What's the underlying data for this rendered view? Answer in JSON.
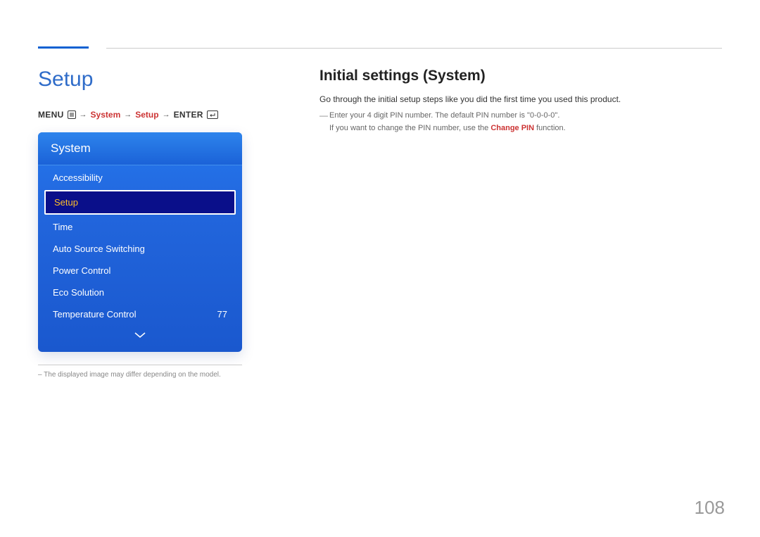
{
  "left": {
    "title": "Setup",
    "breadcrumb": {
      "menu": "MENU",
      "system": "System",
      "setup": "Setup",
      "enter": "ENTER"
    },
    "panel": {
      "header": "System",
      "items": [
        {
          "label": "Accessibility",
          "value": "",
          "selected": false
        },
        {
          "label": "Setup",
          "value": "",
          "selected": true
        },
        {
          "label": "Time",
          "value": "",
          "selected": false
        },
        {
          "label": "Auto Source Switching",
          "value": "",
          "selected": false
        },
        {
          "label": "Power Control",
          "value": "",
          "selected": false
        },
        {
          "label": "Eco Solution",
          "value": "",
          "selected": false
        },
        {
          "label": "Temperature Control",
          "value": "77",
          "selected": false
        }
      ]
    },
    "disclaimer": "– The displayed image may differ depending on the model."
  },
  "right": {
    "title": "Initial settings (System)",
    "body": "Go through the initial setup steps like you did the first time you used this product.",
    "note1": "Enter your 4 digit PIN number. The default PIN number is \"0-0-0-0\".",
    "note2_pre": "If you want to change the PIN number, use the ",
    "note2_em": "Change PIN",
    "note2_post": " function."
  },
  "page_number": "108"
}
